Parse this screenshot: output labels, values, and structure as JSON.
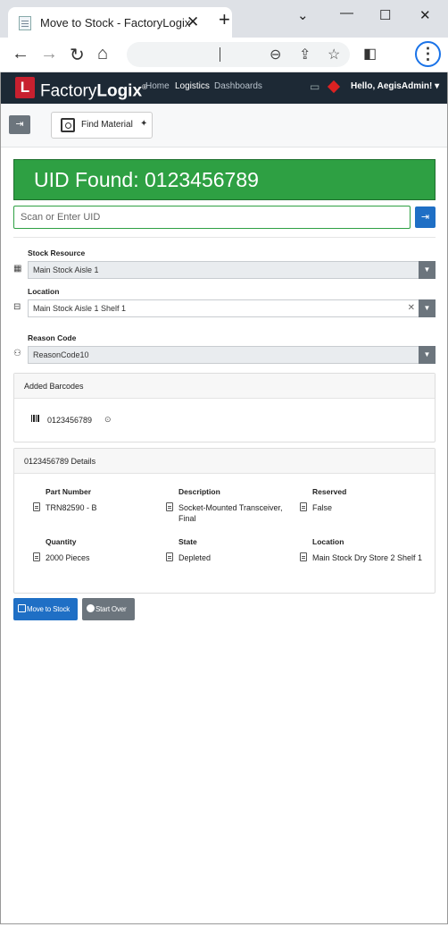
{
  "browser": {
    "tab_title": "Move to Stock - FactoryLogix",
    "tab_close": "✕",
    "new_tab": "+",
    "minimize": "⌄",
    "menu": "⋮"
  },
  "header": {
    "brand_light": "Factory",
    "brand_bold": "Logix",
    "brand_mark": "®",
    "logo_letter": "L",
    "nav": {
      "home": "Home",
      "logistics": "Logistics",
      "dashboards": "Dashboards"
    },
    "user_greeting": "Hello, AegisAdmin! ▾"
  },
  "toolbar": {
    "find_material": "Find Material"
  },
  "banner": {
    "text": "UID Found: 0123456789",
    "color": "#2ea043"
  },
  "uid_input": {
    "placeholder": "Scan or Enter UID",
    "value": ""
  },
  "form": {
    "stock_resource": {
      "label": "Stock Resource",
      "value": "Main Stock Aisle 1"
    },
    "location": {
      "label": "Location",
      "value": "Main Stock Aisle 1 Shelf 1"
    },
    "reason_code": {
      "label": "Reason Code",
      "value": "ReasonCode10"
    }
  },
  "added_barcodes": {
    "title": "Added Barcodes",
    "items": [
      "0123456789"
    ]
  },
  "details": {
    "title": "0123456789 Details",
    "part_number": {
      "label": "Part Number",
      "value": "TRN82590 - B"
    },
    "description": {
      "label": "Description",
      "value": "Socket-Mounted Transceiver, Final"
    },
    "reserved": {
      "label": "Reserved",
      "value": "False"
    },
    "quantity": {
      "label": "Quantity",
      "value": "2000 Pieces"
    },
    "state": {
      "label": "State",
      "value": "Depleted"
    },
    "location": {
      "label": "Location",
      "value": "Main Stock Dry Store 2 Shelf 1"
    }
  },
  "actions": {
    "move_to_stock": "Move to Stock",
    "start_over": "Start Over"
  }
}
